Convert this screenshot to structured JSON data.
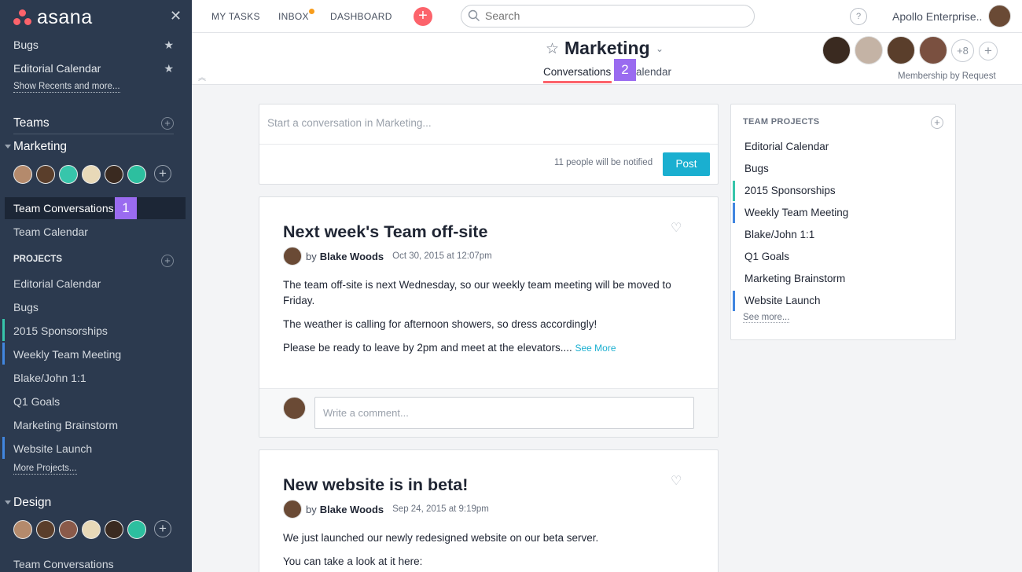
{
  "app": {
    "logo": "asana"
  },
  "sidebar": {
    "favorites": [
      "Bugs",
      "Editorial Calendar"
    ],
    "show_recents": "Show Recents and more...",
    "teams_label": "Teams",
    "marketing_label": "Marketing",
    "nav": [
      "Team Conversations",
      "Team Calendar"
    ],
    "projects_label": "PROJECTS",
    "projects": [
      "Editorial Calendar",
      "Bugs",
      "2015 Sponsorships",
      "Weekly Team Meeting",
      "Blake/John 1:1",
      "Q1 Goals",
      "Marketing Brainstorm",
      "Website Launch"
    ],
    "more_projects": "More Projects...",
    "design_label": "Design",
    "design_nav": "Team Conversations",
    "badge1": "1"
  },
  "topbar": {
    "nav": [
      "MY TASKS",
      "INBOX",
      "DASHBOARD"
    ],
    "search_placeholder": "Search",
    "help": "?",
    "org": "Apollo Enterprise.."
  },
  "header": {
    "title": "Marketing",
    "tabs": [
      "Conversations",
      "Calendar"
    ],
    "tab_calendar_visible": "alendar",
    "badge2": "2",
    "more_members": "+8",
    "membership": "Membership by Request"
  },
  "composer": {
    "placeholder": "Start a conversation in Marketing...",
    "notify": "11 people will be notified",
    "post": "Post"
  },
  "posts": [
    {
      "title": "Next week's Team off-site",
      "by": "by",
      "author": "Blake Woods",
      "date": "Oct 30, 2015 at 12:07pm",
      "paras": [
        "The team off-site is next Wednesday, so our weekly team meeting will be moved to Friday.",
        "The weather is calling for afternoon showers, so dress accordingly!",
        "Please be ready to leave by 2pm and meet at the elevators...."
      ],
      "see_more": "See More",
      "comment_placeholder": "Write a comment..."
    },
    {
      "title": "New website is in beta!",
      "by": "by",
      "author": "Blake Woods",
      "date": "Sep 24, 2015 at 9:19pm",
      "paras": [
        "We just launched our newly redesigned website on our beta server.",
        "You can take a look at it here:"
      ]
    }
  ],
  "team_projects": {
    "title": "TEAM PROJECTS",
    "items": [
      "Editorial Calendar",
      "Bugs",
      "2015 Sponsorships",
      "Weekly Team Meeting",
      "Blake/John 1:1",
      "Q1 Goals",
      "Marketing Brainstorm",
      "Website Launch"
    ],
    "see_more": "See more..."
  },
  "colors": {
    "accent": "#fc636b",
    "teal": "#1aafd0",
    "sidebar": "#2c3a4f",
    "badge": "#9a6bf0",
    "green_bar": "#37c5ab",
    "blue_bar": "#4186e0"
  },
  "icons": [
    "star-icon",
    "close-icon",
    "plus-icon",
    "search-icon",
    "heart-icon",
    "chevron-down-icon"
  ]
}
